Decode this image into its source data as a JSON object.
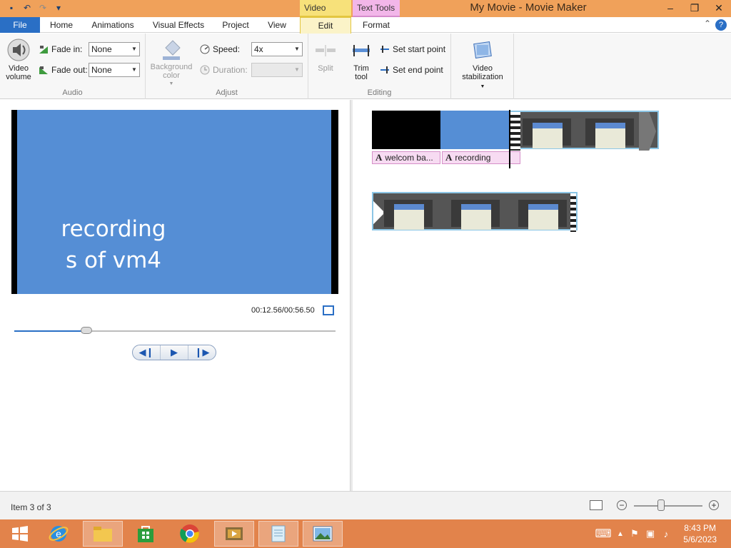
{
  "window": {
    "title": "My Movie - Movie Maker",
    "minimize": "‒",
    "maximize": "❐",
    "close": "✕"
  },
  "context_tabs": {
    "video_tools": "Video Tools",
    "text_tools": "Text Tools"
  },
  "ribbon_tabs": [
    "File",
    "Home",
    "Animations",
    "Visual Effects",
    "Project",
    "View",
    "Edit",
    "Format"
  ],
  "ribbon": {
    "audio": {
      "label": "Audio",
      "video_volume": "Video volume",
      "fade_in_label": "Fade in:",
      "fade_in_value": "None",
      "fade_out_label": "Fade out:",
      "fade_out_value": "None"
    },
    "adjust": {
      "label": "Adjust",
      "background_color": "Background color",
      "speed_label": "Speed:",
      "speed_value": "4x",
      "duration_label": "Duration:",
      "duration_value": ""
    },
    "editing": {
      "label": "Editing",
      "split": "Split",
      "trim_tool": "Trim tool",
      "set_start_point": "Set start point",
      "set_end_point": "Set end point"
    },
    "stabilization": {
      "video_stabilization": "Video stabilization"
    }
  },
  "preview": {
    "caption_line1": "recording",
    "caption_line2": "s of vm4",
    "time": "00:12.56/00:56.50",
    "seek_position": 0.225,
    "colors": {
      "background": "#558ed5",
      "text": "#ffffff"
    }
  },
  "storyboard": {
    "captions": [
      {
        "icon": "A",
        "text": "welcom ba..."
      },
      {
        "icon": "A",
        "text": "recording"
      }
    ]
  },
  "status": {
    "item_text": "Item 3 of 3",
    "zoom_level": 0.4
  },
  "taskbar": {
    "apps": [
      "start-icon",
      "internet-explorer-icon",
      "file-explorer-icon",
      "store-icon",
      "chrome-icon",
      "movie-maker-icon",
      "notepad-icon",
      "photo-viewer-icon"
    ],
    "time": "8:43 PM",
    "date": "5/6/2023"
  }
}
